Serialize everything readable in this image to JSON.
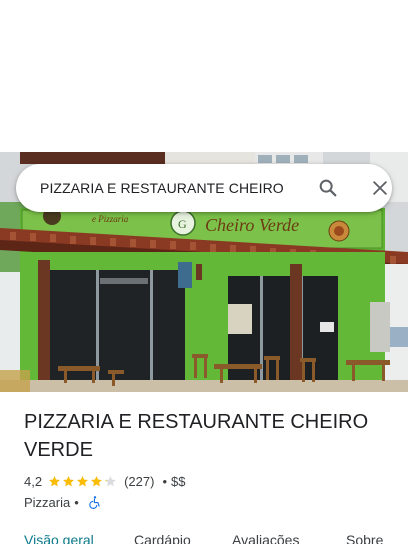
{
  "search": {
    "query": "PIZZARIA E RESTAURANTE CHEIRO VERDE",
    "search_icon": "search-icon",
    "close_icon": "close-icon"
  },
  "hero": {
    "sign_text": "Cheiro Verde",
    "sign_subtext": "e Pizzaria"
  },
  "place": {
    "title": "PIZZARIA E RESTAURANTE CHEIRO VERDE",
    "rating": "4,2",
    "rating_value": 4.2,
    "stars_max": 5,
    "review_count": "(227)",
    "separator": "•",
    "price": "$$",
    "category": "Pizzaria",
    "category_separator": "•",
    "accessibility_icon": "wheelchair-icon"
  },
  "tabs": [
    {
      "label": "Visão geral",
      "active": true
    },
    {
      "label": "Cardápio",
      "active": false
    },
    {
      "label": "Avaliações",
      "active": false
    },
    {
      "label": "Sobre",
      "active": false
    }
  ],
  "colors": {
    "star": "#fbbc04",
    "star_empty": "#dadce0",
    "active_tab": "#0b7a8a",
    "accessibility": "#1a73e8",
    "facade_green": "#5fb332"
  }
}
